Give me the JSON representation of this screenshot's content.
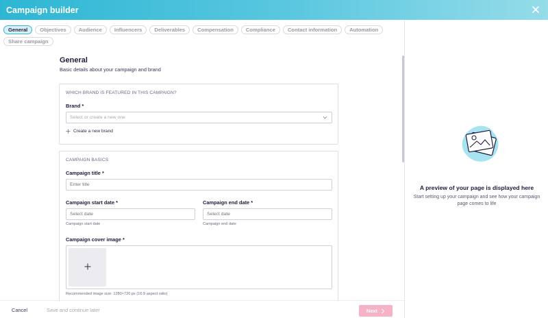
{
  "header": {
    "title": "Campaign builder"
  },
  "tabs": [
    {
      "label": "General",
      "active": true
    },
    {
      "label": "Objectives",
      "active": false
    },
    {
      "label": "Audience",
      "active": false
    },
    {
      "label": "Influencers",
      "active": false
    },
    {
      "label": "Deliverables",
      "active": false
    },
    {
      "label": "Compensation",
      "active": false
    },
    {
      "label": "Compliance",
      "active": false
    },
    {
      "label": "Contact information",
      "active": false
    },
    {
      "label": "Automation",
      "active": false
    },
    {
      "label": "Share campaign",
      "active": false
    }
  ],
  "section": {
    "title": "General",
    "subtitle": "Basic details about your campaign and brand"
  },
  "brand_card": {
    "heading": "WHICH BRAND IS FEATURED IN THIS CAMPAIGN?",
    "brand_label": "Brand *",
    "brand_placeholder": "Select or create a new one",
    "create_link": "Create a new brand"
  },
  "basics_card": {
    "heading": "CAMPAIGN BASICS",
    "title_label": "Campaign title *",
    "title_placeholder": "Enter title",
    "start_label": "Campaign start date *",
    "start_placeholder": "Select date",
    "start_help": "Campaign start date",
    "end_label": "Campaign end date *",
    "end_placeholder": "Select date",
    "end_help": "Campaign end date",
    "cover_label": "Campaign cover image *",
    "cover_help": "Recommended image size: 1280×720 px (16:9 aspect ratio)"
  },
  "footer": {
    "cancel": "Cancel",
    "save_later": "Save and continue later",
    "next": "Next"
  },
  "preview": {
    "title": "A preview of your page is displayed here",
    "subtitle": "Start setting up your campaign and see how your campaign page comes to life"
  },
  "colors": {
    "header_start": "#2db6d4",
    "header_end": "#96dce9",
    "accent": "#35b7d6",
    "next_button": "#f7b3c6"
  },
  "icons": {
    "close": "close-icon",
    "chevron": "chevron-down-icon",
    "add": "plus-icon",
    "preview": "image-preview-icon",
    "next_arrow": "chevron-right-icon"
  }
}
